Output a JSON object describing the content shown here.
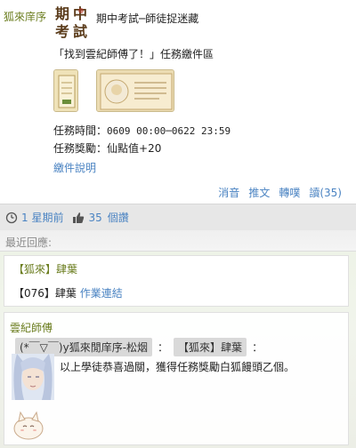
{
  "post": {
    "poster": "狐來庠序",
    "badge_text": "期中考試",
    "title": "期中考試─師徒捉迷藏",
    "line": "「找到雲紀師傅了！」任務繳件區",
    "time_label": "任務時間：",
    "time_value": "0609 00:00─0622 23:59",
    "reward_label": "任務獎勵：",
    "reward_value": "仙點值+20",
    "desc_link": "繳件說明",
    "actions": {
      "ignore": "消音",
      "retweet": "推文",
      "repost": "轉噗",
      "read": "讀",
      "read_count": "(35)"
    }
  },
  "status": {
    "time": "1 星期前",
    "likes": "35",
    "likes_label": "個讚"
  },
  "comments": {
    "header": "最近回應:",
    "first": {
      "author": "【狐來】肆葉",
      "body_prefix": "【076】肆葉",
      "body_link": "作業連結"
    },
    "second": {
      "author": "雲紀師傅",
      "tag1": "(*￣▽￣)y狐來閒庠序-松烟",
      "colon1": "：",
      "tag2": "【狐來】肆葉",
      "colon2": "：",
      "body": "以上學徒恭喜過關，獲得任務獎勵白狐饅頭乙個。"
    }
  }
}
